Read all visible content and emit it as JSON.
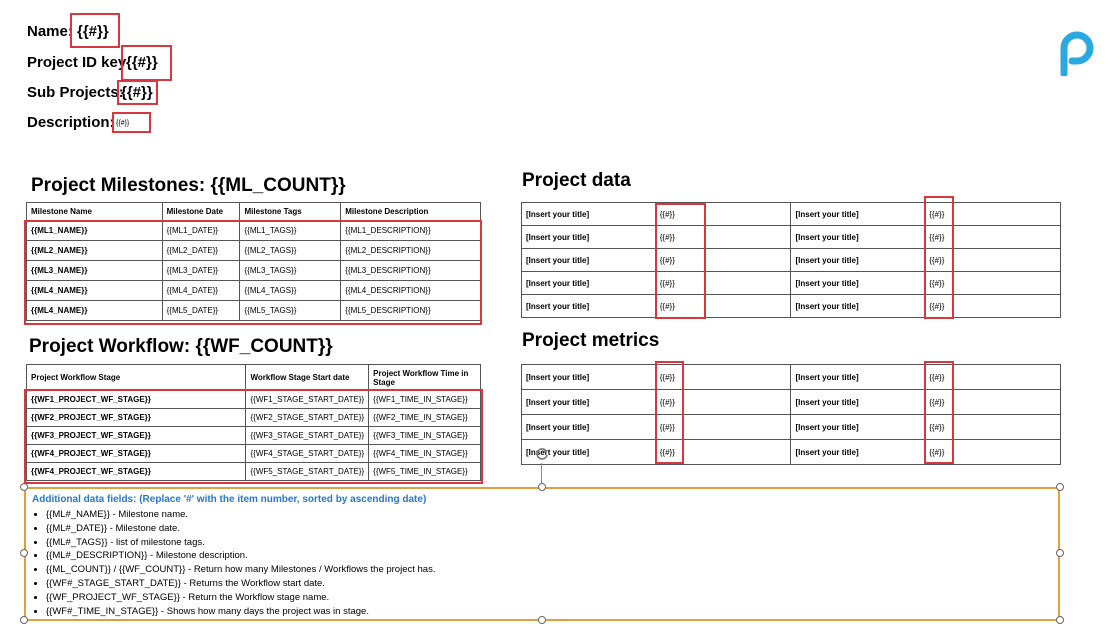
{
  "header": {
    "name_label": "Name:",
    "name_value": "{{#}}",
    "project_id_label": "Project ID key",
    "project_id_value": "{{#}}",
    "sub_projects_label": "Sub Projects:",
    "sub_projects_value": "{{#}}",
    "description_label": "Description:",
    "description_value": "{{#}}"
  },
  "colors": {
    "highlight": "#d9363e",
    "accent_blue": "#2878c8",
    "frame_orange": "#e0a040",
    "logo": "#29a9e0"
  },
  "logo": {
    "icon": "p-logo-icon"
  },
  "milestones": {
    "title": "Project Milestones: {{ML_COUNT}}",
    "headers": [
      "Milestone Name",
      "Milestone Date",
      "Milestone Tags",
      "Milestone Description"
    ],
    "rows": [
      [
        "{{ML1_NAME}}",
        "{{ML1_DATE}}",
        "{{ML1_TAGS}}",
        "{{ML1_DESCRIPTION}}"
      ],
      [
        "{{ML2_NAME}}",
        "{{ML2_DATE}}",
        "{{ML2_TAGS}}",
        "{{ML2_DESCRIPTION}}"
      ],
      [
        "{{ML3_NAME}}",
        "{{ML3_DATE}}",
        "{{ML3_TAGS}}",
        "{{ML3_DESCRIPTION}}"
      ],
      [
        "{{ML4_NAME}}",
        "{{ML4_DATE}}",
        "{{ML4_TAGS}}",
        "{{ML4_DESCRIPTION}}"
      ],
      [
        "{{ML4_NAME}}",
        "{{ML5_DATE}}",
        "{{ML5_TAGS}}",
        "{{ML5_DESCRIPTION}}"
      ]
    ]
  },
  "workflow": {
    "title": "Project Workflow: {{WF_COUNT}}",
    "headers": [
      "Project Workflow Stage",
      "Workflow Stage Start date",
      "Project Workflow Time in Stage"
    ],
    "rows": [
      [
        "{{WF1_PROJECT_WF_STAGE}}",
        "{{WF1_STAGE_START_DATE}}",
        "{{WF1_TIME_IN_STAGE}}"
      ],
      [
        "{{WF2_PROJECT_WF_STAGE}}",
        "{{WF2_STAGE_START_DATE}}",
        "{{WF2_TIME_IN_STAGE}}"
      ],
      [
        "{{WF3_PROJECT_WF_STAGE}}",
        "{{WF3_STAGE_START_DATE}}",
        "{{WF3_TIME_IN_STAGE}}"
      ],
      [
        "{{WF4_PROJECT_WF_STAGE}}",
        "{{WF4_STAGE_START_DATE}}",
        "{{WF4_TIME_IN_STAGE}}"
      ],
      [
        "{{WF4_PROJECT_WF_STAGE}}",
        "{{WF5_STAGE_START_DATE}}",
        "{{WF5_TIME_IN_STAGE}}"
      ]
    ]
  },
  "project_data": {
    "title": "Project data",
    "rows": [
      [
        "[Insert your title]",
        "{{#}}",
        "[Insert your title]",
        "{{#}}"
      ],
      [
        "[Insert your title]",
        "{{#}}",
        "[Insert your title]",
        "{{#}}"
      ],
      [
        "[Insert your title]",
        "{{#}}",
        "[Insert your title]",
        "{{#}}"
      ],
      [
        "[Insert your title]",
        "{{#}}",
        "[Insert your title]",
        "{{#}}"
      ],
      [
        "[Insert your title]",
        "{{#}}",
        "[Insert your title]",
        "{{#}}"
      ]
    ]
  },
  "project_metrics": {
    "title": "Project metrics",
    "rows": [
      [
        "[Insert your title]",
        "{{#}}",
        "[Insert your title]",
        "{{#}}"
      ],
      [
        "[Insert your title]",
        "{{#}}",
        "[Insert your title]",
        "{{#}}"
      ],
      [
        "[Insert your title]",
        "{{#}}",
        "[Insert your title]",
        "{{#}}"
      ],
      [
        "[Insert your title]",
        "{{#}}",
        "[Insert your title]",
        "{{#}}"
      ]
    ]
  },
  "notes": {
    "title": "Additional data fields: (Replace '#' with the item number, sorted by ascending date)",
    "items": [
      "{{ML#_NAME}} - Milestone name.",
      "{{ML#_DATE}} - Milestone date.",
      "{{ML#_TAGS}} - list of milestone tags.",
      "{{ML#_DESCRIPTION}} - Milestone description.",
      "{{ML_COUNT}} / {{WF_COUNT}} - Return how many Milestones / Workflows the project has.",
      "{{WF#_STAGE_START_DATE}} - Returns the Workflow start date.",
      "{{WF_PROJECT_WF_STAGE}} - Return the Workflow stage name.",
      "{{WF#_TIME_IN_STAGE}} - Shows how many days the project was in stage."
    ]
  }
}
